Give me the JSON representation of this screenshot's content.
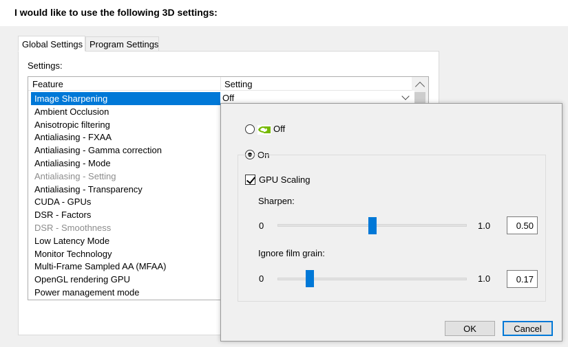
{
  "page": {
    "heading": "I would like to use the following 3D settings:"
  },
  "tabs": [
    {
      "label": "Global Settings",
      "active": true
    },
    {
      "label": "Program Settings",
      "active": false
    }
  ],
  "settings_label": "Settings:",
  "table": {
    "columns": [
      "Feature",
      "Setting"
    ],
    "selected_value": "Off",
    "rows": [
      {
        "label": "Image Sharpening",
        "state": "selected"
      },
      {
        "label": "Ambient Occlusion",
        "state": "normal"
      },
      {
        "label": "Anisotropic filtering",
        "state": "normal"
      },
      {
        "label": "Antialiasing - FXAA",
        "state": "normal"
      },
      {
        "label": "Antialiasing - Gamma correction",
        "state": "normal"
      },
      {
        "label": "Antialiasing - Mode",
        "state": "normal"
      },
      {
        "label": "Antialiasing - Setting",
        "state": "disabled"
      },
      {
        "label": "Antialiasing - Transparency",
        "state": "normal"
      },
      {
        "label": "CUDA - GPUs",
        "state": "normal"
      },
      {
        "label": "DSR - Factors",
        "state": "normal"
      },
      {
        "label": "DSR - Smoothness",
        "state": "disabled"
      },
      {
        "label": "Low Latency Mode",
        "state": "normal"
      },
      {
        "label": "Monitor Technology",
        "state": "normal"
      },
      {
        "label": "Multi-Frame Sampled AA (MFAA)",
        "state": "normal"
      },
      {
        "label": "OpenGL rendering GPU",
        "state": "normal"
      },
      {
        "label": "Power management mode",
        "state": "normal"
      }
    ]
  },
  "popup": {
    "off_label": "Off",
    "on_label": "On",
    "selected_option": "on",
    "gpu_scaling_label": "GPU Scaling",
    "gpu_scaling_checked": true,
    "sharpen": {
      "label": "Sharpen:",
      "min_label": "0",
      "max_label": "1.0",
      "value": "0.50",
      "fraction": 0.5
    },
    "film_grain": {
      "label": "Ignore film grain:",
      "min_label": "0",
      "max_label": "1.0",
      "value": "0.17",
      "fraction": 0.17
    },
    "ok_label": "OK",
    "cancel_label": "Cancel"
  },
  "colors": {
    "selection": "#0078d7",
    "nvidia_green": "#76b900",
    "panel_bg": "#f0f0f0"
  }
}
